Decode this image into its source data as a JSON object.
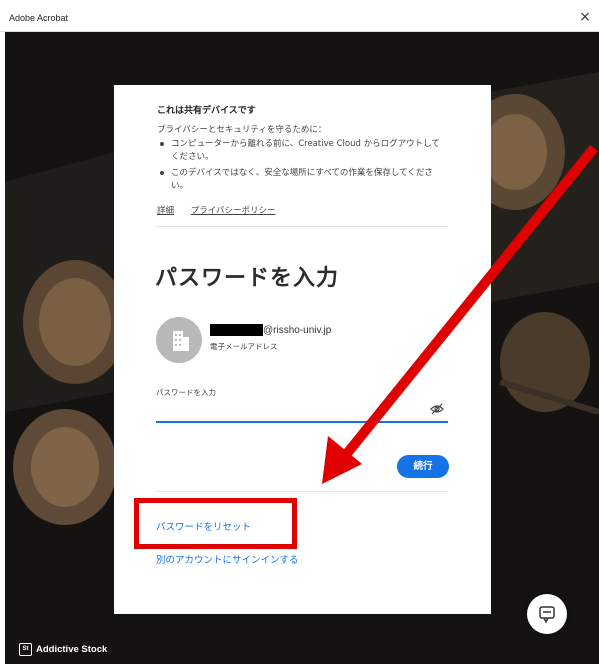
{
  "window": {
    "title": "Adobe Acrobat",
    "close_symbol": "×"
  },
  "notice": {
    "title": "これは共有デバイスです",
    "intro": "プライバシーとセキュリティを守るために：",
    "bullets": [
      "コンピューターから離れる前に、Creative Cloud からログアウトしてください。",
      "このデバイスではなく、安全な場所にすべての作業を保存してください。"
    ],
    "links": [
      "詳細",
      "プライバシーポリシー"
    ]
  },
  "signin": {
    "heading": "パスワードを入力",
    "email_suffix": "@rissho-univ.jp",
    "email_label": "電子メールアドレス",
    "password_label": "パスワードを入力",
    "password_value": "",
    "continue_label": "続行",
    "reset_link": "パスワードをリセット",
    "other_account_link": "別のアカウントにサインインする"
  },
  "footer": {
    "brand_badge": "St",
    "brand": "Addictive Stock"
  },
  "colors": {
    "accent": "#1473e6",
    "annotation": "#e00000"
  },
  "icons": {
    "eye": "eye-slash-icon",
    "chat": "chat-icon",
    "avatar": "building-icon"
  }
}
